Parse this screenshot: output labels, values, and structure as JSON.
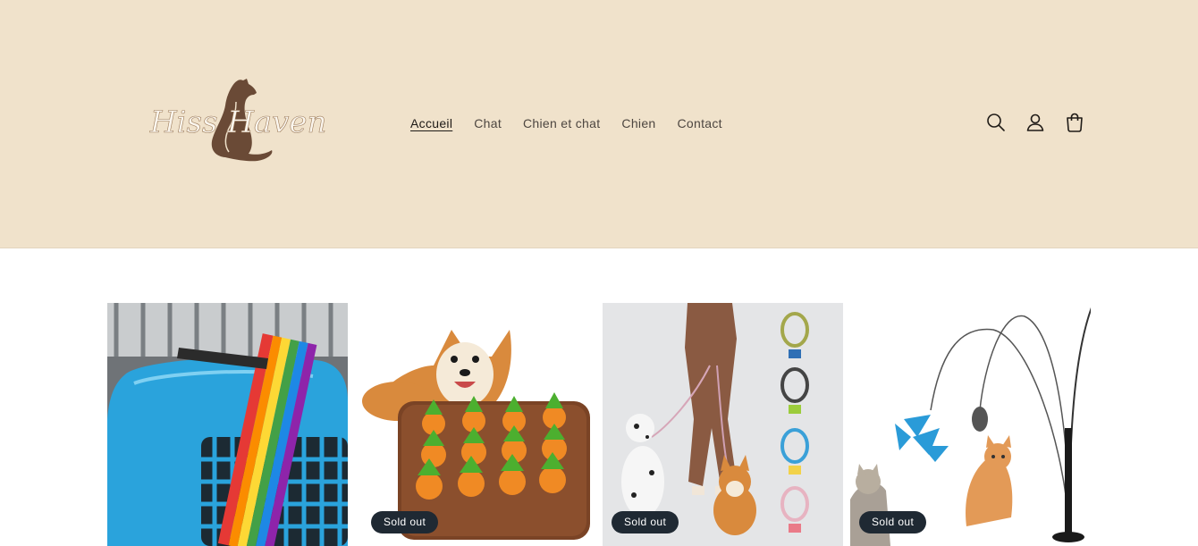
{
  "header": {
    "logo_text": "Hiss Haven",
    "nav": [
      {
        "label": "Accueil",
        "active": true
      },
      {
        "label": "Chat",
        "active": false
      },
      {
        "label": "Chien et chat",
        "active": false
      },
      {
        "label": "Chien",
        "active": false
      },
      {
        "label": "Contact",
        "active": false
      }
    ],
    "icons": [
      "search-icon",
      "account-icon",
      "cart-icon"
    ]
  },
  "products": [
    {
      "image": "blue pet carrier with rainbow strap",
      "sold_out": false,
      "badge": ""
    },
    {
      "image": "corgi with carrot snuffle mat",
      "sold_out": true,
      "badge": "Sold out"
    },
    {
      "image": "dog leashes with dogs",
      "sold_out": true,
      "badge": "Sold out"
    },
    {
      "image": "cat teaser wand toy with cats",
      "sold_out": true,
      "badge": "Sold out"
    }
  ],
  "colors": {
    "header_bg": "#f0e2cb",
    "badge_bg": "#1f2933",
    "text": "#4d4640"
  }
}
